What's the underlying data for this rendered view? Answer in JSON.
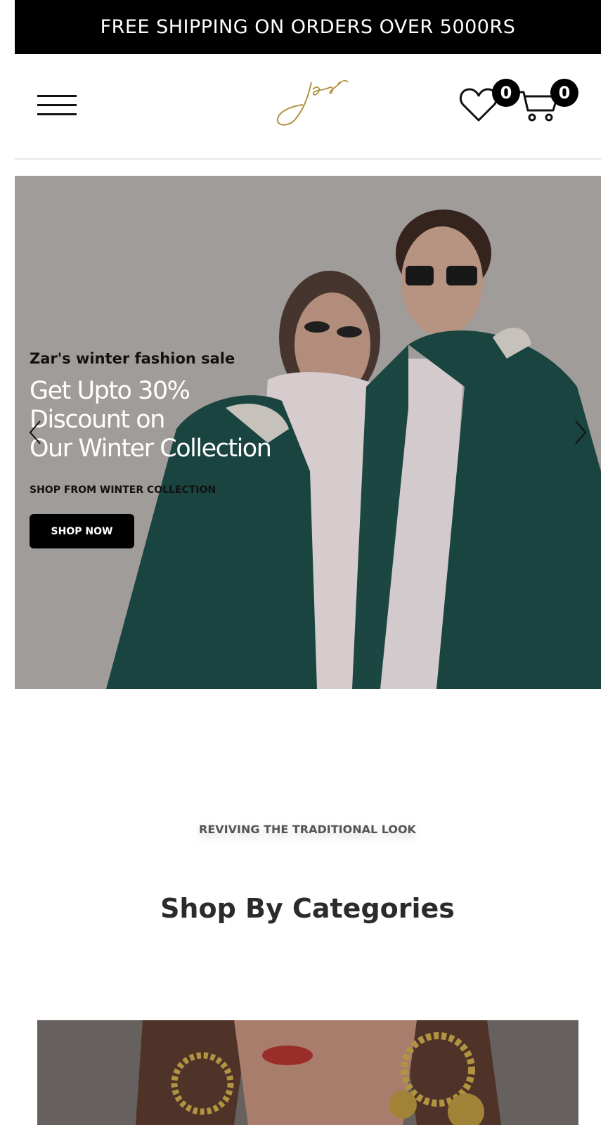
{
  "announcement": {
    "text": "FREE SHIPPING ON ORDERS OVER 5000RS"
  },
  "header": {
    "logo_text": "zar",
    "wishlist_count": "0",
    "cart_count": "0"
  },
  "hero": {
    "eyebrow": "Zar's winter fashion sale",
    "title_lines": [
      "Get Upto 30%",
      "Discount on",
      "Our Winter Collection"
    ],
    "subtitle": "SHOP FROM WINTER COLLECTION",
    "button_label": "SHOP NOW"
  },
  "section": {
    "tagline": "REVIVING THE TRADITIONAL LOOK",
    "title": "Shop By Categories"
  },
  "icons": {
    "menu": "hamburger-menu-icon",
    "wishlist": "heart-icon",
    "cart": "cart-icon",
    "prev": "chevron-left-icon",
    "next": "chevron-right-icon"
  },
  "colors": {
    "announcement_bg": "#000000",
    "logo_gold": "#b0913f",
    "jacket_green": "#1d4a45"
  }
}
